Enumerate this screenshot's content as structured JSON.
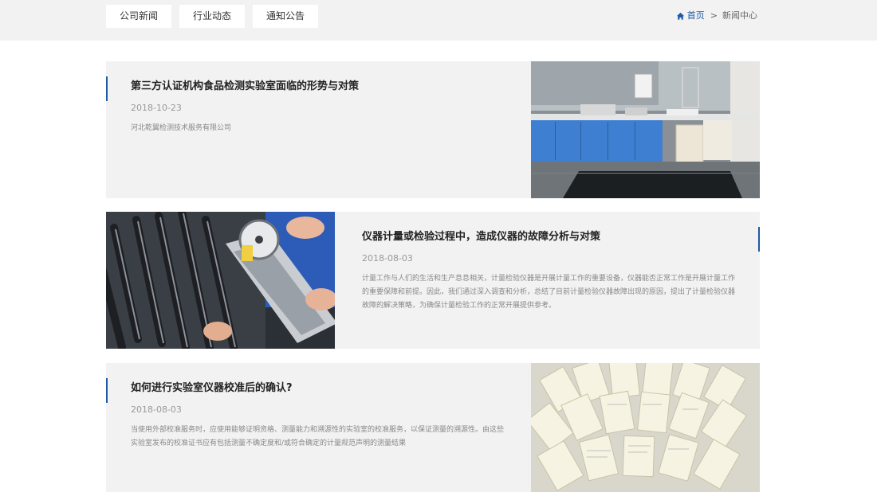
{
  "tabs": [
    {
      "label": "公司新闻"
    },
    {
      "label": "行业动态"
    },
    {
      "label": "通知公告"
    }
  ],
  "breadcrumb": {
    "home": "首页",
    "separator": ">",
    "current": "新闻中心"
  },
  "colors": {
    "accent": "#1f5aa6",
    "card_bg": "#f2f2f2",
    "topbar_bg": "#f2f2f2"
  },
  "news": [
    {
      "title": "第三方认证机构食品检测实验室面临的形势与对策",
      "date": "2018-10-23",
      "desc": "河北乾翼检测技术服务有限公司",
      "image": "laboratory-photo"
    },
    {
      "title": "仪器计量或检验过程中，造成仪器的故障分析与对策",
      "date": "2018-08-03",
      "desc": "计量工作与人们的生活和生产息息相关，计量检验仪器是开展计量工作的重要设备，仪器能否正常工作是开展计量工作的重要保障和前提。因此，我们通过深入调查和分析，总结了目前计量检验仪器故障出现的原因，提出了计量检验仪器故障的解决策略，为确保计量检验工作的正常开展提供参考。",
      "image": "caliper-measuring-tools-photo"
    },
    {
      "title": "如何进行实验室仪器校准后的确认?",
      "date": "2018-08-03",
      "desc": "当使用外部校准服务时，应使用能够证明资格、测量能力和溯源性的实验室的校准服务，以保证测量的溯源性。由这些实验室发布的校准证书应有包括测量不确定度和/或符合确定的计量规范声明的测量结果",
      "image": "calibration-certificates-photo"
    }
  ]
}
